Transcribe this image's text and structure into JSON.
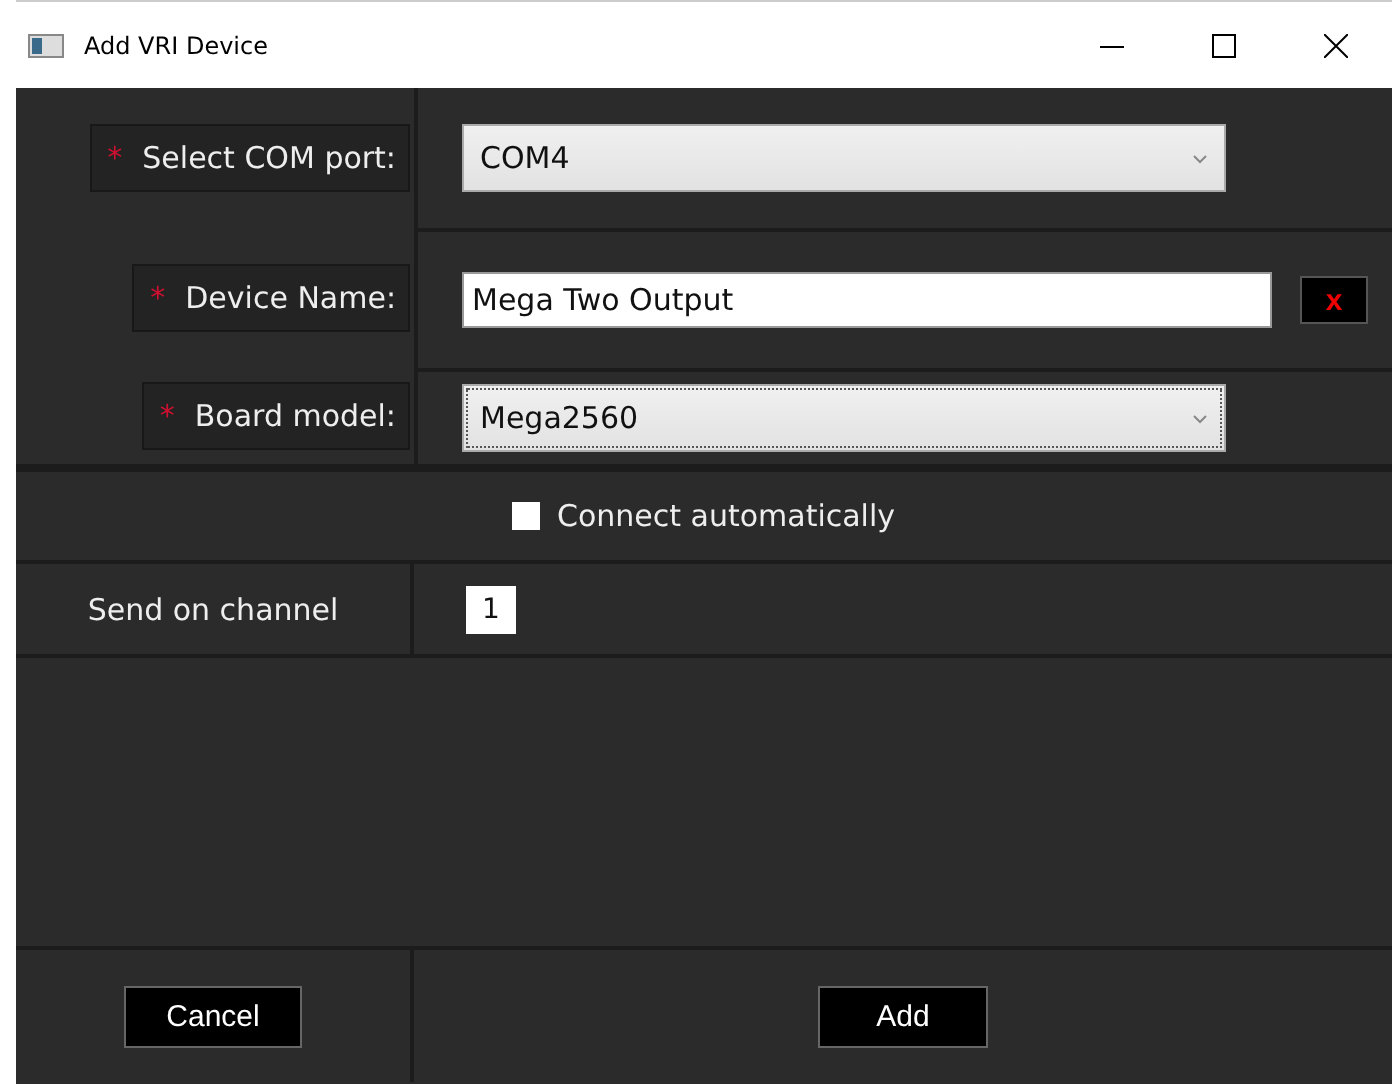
{
  "window": {
    "title": "Add VRI Device"
  },
  "fields": [
    {
      "kind": "select",
      "label": "Select COM port:",
      "required_mark": "*",
      "value": "COM4",
      "focused": false
    },
    {
      "kind": "text",
      "label": "Device Name:",
      "required_mark": "*",
      "value": "Mega Two Output",
      "clear_label": "x"
    },
    {
      "kind": "select",
      "label": "Board model:",
      "required_mark": "*",
      "value": "Mega2560",
      "focused": true
    }
  ],
  "connect_automatically": {
    "label": "Connect automatically",
    "checked": false
  },
  "channel": {
    "label": "Send on channel",
    "value": "1"
  },
  "buttons": [
    {
      "label": "Cancel"
    },
    {
      "label": "Add"
    }
  ]
}
